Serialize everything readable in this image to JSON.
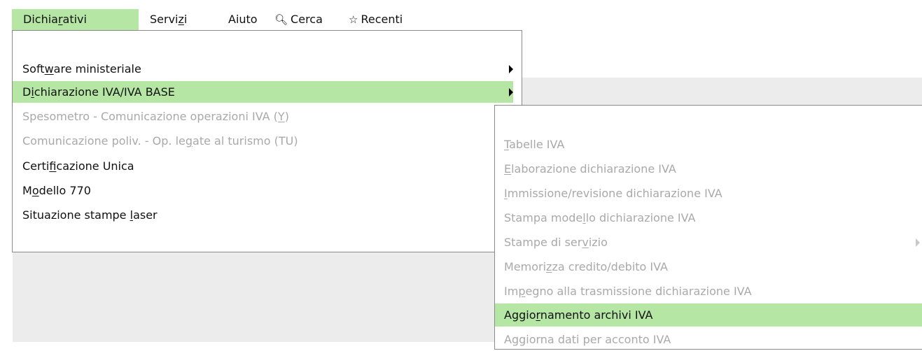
{
  "menubar": {
    "dichiarativi": {
      "pre": "Dichia",
      "acc": "r",
      "post": "ativi"
    },
    "servizi": {
      "pre": "Servi",
      "acc": "z",
      "post": "i"
    },
    "aiuto": "Aiuto",
    "cerca": "Cerca",
    "recenti": "Recenti",
    "cerca_icon": "search-icon",
    "recenti_icon": "star-icon"
  },
  "dropdown": {
    "software": {
      "pre": "Soft",
      "acc": "w",
      "post": "are ministeriale"
    },
    "iva": {
      "pre": "D",
      "acc": "i",
      "post": "chiarazione IVA/IVA BASE"
    },
    "spesometro": {
      "pre": "Spesometro - Comunicazione operazioni IVA (",
      "acc": "Y",
      "post": ")"
    },
    "polivalente": {
      "pre": "Comunicazione poliv. - Op. le",
      "acc": "g",
      "post": "ate al turismo (TU)"
    },
    "certificazione": {
      "pre": "Certi",
      "acc": "f",
      "post": "icazione Unica"
    },
    "modello770": {
      "pre": "M",
      "acc": "o",
      "post": "dello 770"
    },
    "laser": {
      "pre": "Situazione stampe ",
      "acc": "l",
      "post": "aser"
    }
  },
  "submenu": {
    "tabelle": {
      "pre": "",
      "acc": "T",
      "post": "abelle IVA"
    },
    "elaborazione": {
      "pre": "",
      "acc": "E",
      "post": "laborazione dichiarazione IVA"
    },
    "immissione": {
      "pre": "",
      "acc": "I",
      "post": "mmissione/revisione dichiarazione IVA"
    },
    "stampa_modello": {
      "pre": "Stampa mode",
      "acc": "l",
      "post": "lo dichiarazione IVA"
    },
    "stampe_servizio": {
      "pre": "Stampe di ser",
      "acc": "v",
      "post": "izio"
    },
    "memorizza": {
      "pre": "Memori",
      "acc": "z",
      "post": "za credito/debito IVA"
    },
    "impegno": {
      "pre": "Im",
      "acc": "p",
      "post": "egno alla trasmissione dichiarazione IVA"
    },
    "aggiornamento": {
      "pre": "Aggio",
      "acc": "r",
      "post": "namento archivi IVA"
    },
    "acconto": "Aggiorna dati per acconto IVA"
  },
  "colors": {
    "highlight": "#b5e6a3",
    "disabled": "#a9a9a9",
    "grey_bg": "#ececec"
  }
}
